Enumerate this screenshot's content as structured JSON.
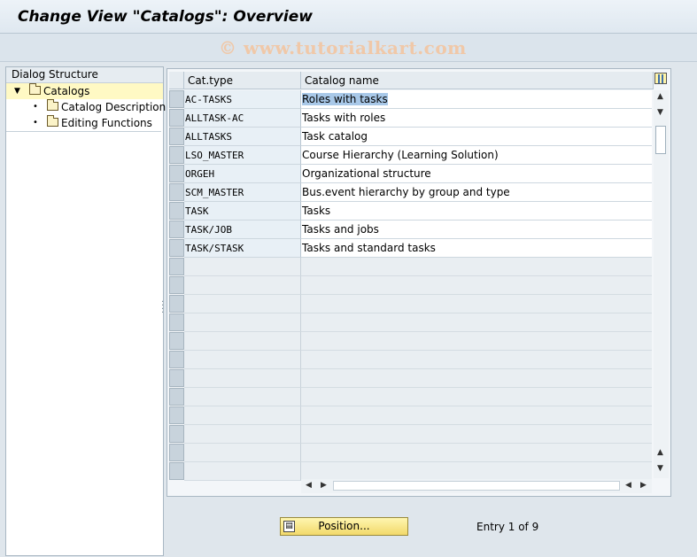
{
  "window": {
    "title": "Change View \"Catalogs\": Overview"
  },
  "watermark": "© www.tutorialkart.com",
  "dialog_structure": {
    "header": "Dialog Structure",
    "items": [
      {
        "label": "Catalogs",
        "level": 0,
        "expanded": true,
        "selected": true
      },
      {
        "label": "Catalog Description",
        "level": 1
      },
      {
        "label": "Editing Functions",
        "level": 1
      }
    ]
  },
  "table": {
    "columns": [
      "Cat.type",
      "Catalog name"
    ],
    "rows": [
      {
        "type": "AC-TASKS",
        "name": "Roles with tasks"
      },
      {
        "type": "ALLTASK-AC",
        "name": "Tasks with roles"
      },
      {
        "type": "ALLTASKS",
        "name": "Task catalog"
      },
      {
        "type": "LSO_MASTER",
        "name": "Course Hierarchy (Learning Solution)"
      },
      {
        "type": "ORGEH",
        "name": "Organizational structure"
      },
      {
        "type": "SCM_MASTER",
        "name": "Bus.event hierarchy by group and type"
      },
      {
        "type": "TASK",
        "name": "Tasks"
      },
      {
        "type": "TASK/JOB",
        "name": "Tasks and jobs"
      },
      {
        "type": "TASK/STASK",
        "name": "Tasks and standard tasks"
      }
    ],
    "empty_rows": 12
  },
  "footer": {
    "position_button": "Position...",
    "entry_text": "Entry 1 of 9"
  }
}
